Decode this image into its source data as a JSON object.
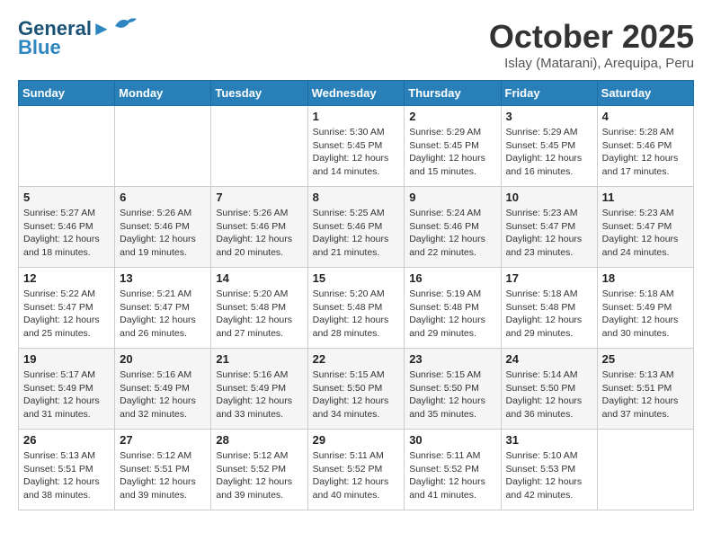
{
  "header": {
    "logo_line1": "General",
    "logo_line2": "Blue",
    "month": "October 2025",
    "location": "Islay (Matarani), Arequipa, Peru"
  },
  "weekdays": [
    "Sunday",
    "Monday",
    "Tuesday",
    "Wednesday",
    "Thursday",
    "Friday",
    "Saturday"
  ],
  "weeks": [
    [
      {
        "day": "",
        "info": ""
      },
      {
        "day": "",
        "info": ""
      },
      {
        "day": "",
        "info": ""
      },
      {
        "day": "1",
        "info": "Sunrise: 5:30 AM\nSunset: 5:45 PM\nDaylight: 12 hours\nand 14 minutes."
      },
      {
        "day": "2",
        "info": "Sunrise: 5:29 AM\nSunset: 5:45 PM\nDaylight: 12 hours\nand 15 minutes."
      },
      {
        "day": "3",
        "info": "Sunrise: 5:29 AM\nSunset: 5:45 PM\nDaylight: 12 hours\nand 16 minutes."
      },
      {
        "day": "4",
        "info": "Sunrise: 5:28 AM\nSunset: 5:46 PM\nDaylight: 12 hours\nand 17 minutes."
      }
    ],
    [
      {
        "day": "5",
        "info": "Sunrise: 5:27 AM\nSunset: 5:46 PM\nDaylight: 12 hours\nand 18 minutes."
      },
      {
        "day": "6",
        "info": "Sunrise: 5:26 AM\nSunset: 5:46 PM\nDaylight: 12 hours\nand 19 minutes."
      },
      {
        "day": "7",
        "info": "Sunrise: 5:26 AM\nSunset: 5:46 PM\nDaylight: 12 hours\nand 20 minutes."
      },
      {
        "day": "8",
        "info": "Sunrise: 5:25 AM\nSunset: 5:46 PM\nDaylight: 12 hours\nand 21 minutes."
      },
      {
        "day": "9",
        "info": "Sunrise: 5:24 AM\nSunset: 5:46 PM\nDaylight: 12 hours\nand 22 minutes."
      },
      {
        "day": "10",
        "info": "Sunrise: 5:23 AM\nSunset: 5:47 PM\nDaylight: 12 hours\nand 23 minutes."
      },
      {
        "day": "11",
        "info": "Sunrise: 5:23 AM\nSunset: 5:47 PM\nDaylight: 12 hours\nand 24 minutes."
      }
    ],
    [
      {
        "day": "12",
        "info": "Sunrise: 5:22 AM\nSunset: 5:47 PM\nDaylight: 12 hours\nand 25 minutes."
      },
      {
        "day": "13",
        "info": "Sunrise: 5:21 AM\nSunset: 5:47 PM\nDaylight: 12 hours\nand 26 minutes."
      },
      {
        "day": "14",
        "info": "Sunrise: 5:20 AM\nSunset: 5:48 PM\nDaylight: 12 hours\nand 27 minutes."
      },
      {
        "day": "15",
        "info": "Sunrise: 5:20 AM\nSunset: 5:48 PM\nDaylight: 12 hours\nand 28 minutes."
      },
      {
        "day": "16",
        "info": "Sunrise: 5:19 AM\nSunset: 5:48 PM\nDaylight: 12 hours\nand 29 minutes."
      },
      {
        "day": "17",
        "info": "Sunrise: 5:18 AM\nSunset: 5:48 PM\nDaylight: 12 hours\nand 29 minutes."
      },
      {
        "day": "18",
        "info": "Sunrise: 5:18 AM\nSunset: 5:49 PM\nDaylight: 12 hours\nand 30 minutes."
      }
    ],
    [
      {
        "day": "19",
        "info": "Sunrise: 5:17 AM\nSunset: 5:49 PM\nDaylight: 12 hours\nand 31 minutes."
      },
      {
        "day": "20",
        "info": "Sunrise: 5:16 AM\nSunset: 5:49 PM\nDaylight: 12 hours\nand 32 minutes."
      },
      {
        "day": "21",
        "info": "Sunrise: 5:16 AM\nSunset: 5:49 PM\nDaylight: 12 hours\nand 33 minutes."
      },
      {
        "day": "22",
        "info": "Sunrise: 5:15 AM\nSunset: 5:50 PM\nDaylight: 12 hours\nand 34 minutes."
      },
      {
        "day": "23",
        "info": "Sunrise: 5:15 AM\nSunset: 5:50 PM\nDaylight: 12 hours\nand 35 minutes."
      },
      {
        "day": "24",
        "info": "Sunrise: 5:14 AM\nSunset: 5:50 PM\nDaylight: 12 hours\nand 36 minutes."
      },
      {
        "day": "25",
        "info": "Sunrise: 5:13 AM\nSunset: 5:51 PM\nDaylight: 12 hours\nand 37 minutes."
      }
    ],
    [
      {
        "day": "26",
        "info": "Sunrise: 5:13 AM\nSunset: 5:51 PM\nDaylight: 12 hours\nand 38 minutes."
      },
      {
        "day": "27",
        "info": "Sunrise: 5:12 AM\nSunset: 5:51 PM\nDaylight: 12 hours\nand 39 minutes."
      },
      {
        "day": "28",
        "info": "Sunrise: 5:12 AM\nSunset: 5:52 PM\nDaylight: 12 hours\nand 39 minutes."
      },
      {
        "day": "29",
        "info": "Sunrise: 5:11 AM\nSunset: 5:52 PM\nDaylight: 12 hours\nand 40 minutes."
      },
      {
        "day": "30",
        "info": "Sunrise: 5:11 AM\nSunset: 5:52 PM\nDaylight: 12 hours\nand 41 minutes."
      },
      {
        "day": "31",
        "info": "Sunrise: 5:10 AM\nSunset: 5:53 PM\nDaylight: 12 hours\nand 42 minutes."
      },
      {
        "day": "",
        "info": ""
      }
    ]
  ]
}
